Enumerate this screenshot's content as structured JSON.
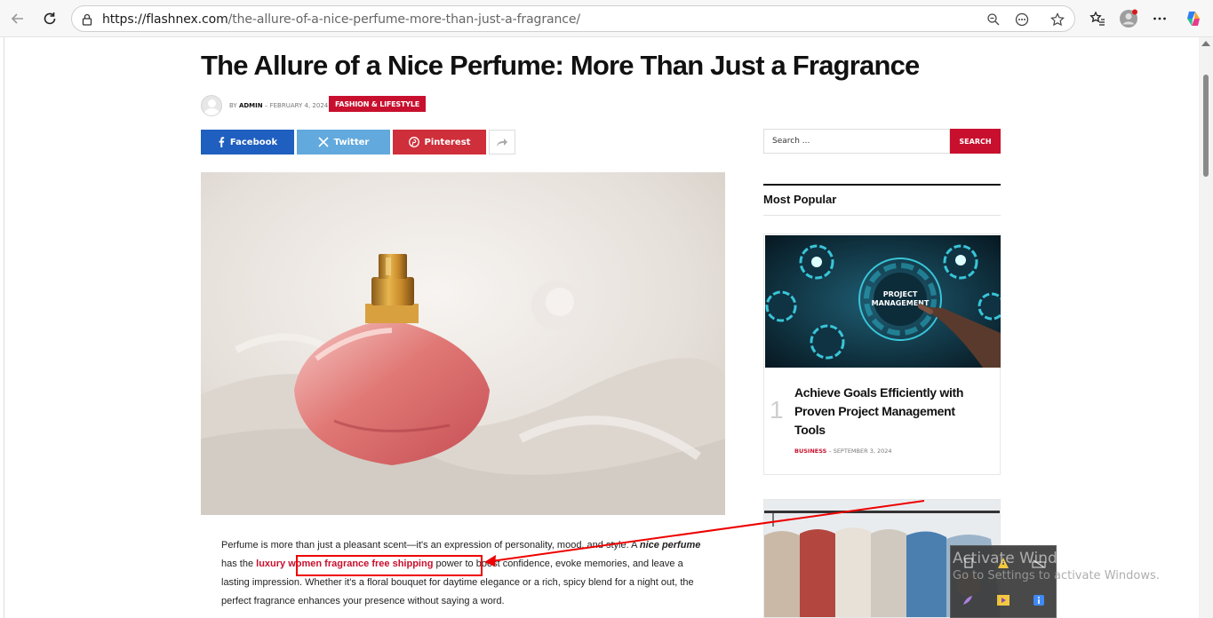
{
  "browser": {
    "url_host": "https://flashnex.com",
    "url_path": "/the-allure-of-a-nice-perfume-more-than-just-a-fragrance/"
  },
  "article": {
    "title": "The Allure of a Nice Perfume: More Than Just a Fragrance",
    "by": "BY",
    "author": "ADMIN",
    "date": "FEBRUARY 4, 2024",
    "category": "FASHION & LIFESTYLE",
    "share": {
      "facebook": "Facebook",
      "twitter": "Twitter",
      "pinterest": "Pinterest"
    },
    "body": {
      "p1_a": "Perfume is more than just a pleasant scent—it's an expression of personality, mood, and style. A ",
      "p1_ital": "nice perfume",
      "p1_b": " has the ",
      "p1_link": "luxury women fragrance free shipping",
      "p1_c": " power to boost confidence, evoke memories, and leave a lasting impression. Whether it's a floral bouquet for daytime elegance or a rich, spicy blend for a night out, the perfect fragrance enhances your presence without saying a word."
    }
  },
  "sidebar": {
    "search_placeholder": "Search ...",
    "search_button": "SEARCH",
    "widget_title": "Most Popular",
    "popular": [
      {
        "rank": "1",
        "title": "Achieve Goals Efficiently with Proven Project Management Tools",
        "category": "BUSINESS",
        "date": "SEPTEMBER 3, 2024",
        "image_text": "PROJECT MANAGEMENT"
      }
    ]
  },
  "overlay": {
    "watermark_line1": "Activate Windows",
    "watermark_line2": "Go to Settings to activate Windows."
  },
  "colors": {
    "accent": "#c8102e",
    "facebook": "#1f5fbf",
    "twitter": "#62a9dd",
    "pinterest": "#ce2f3a"
  }
}
